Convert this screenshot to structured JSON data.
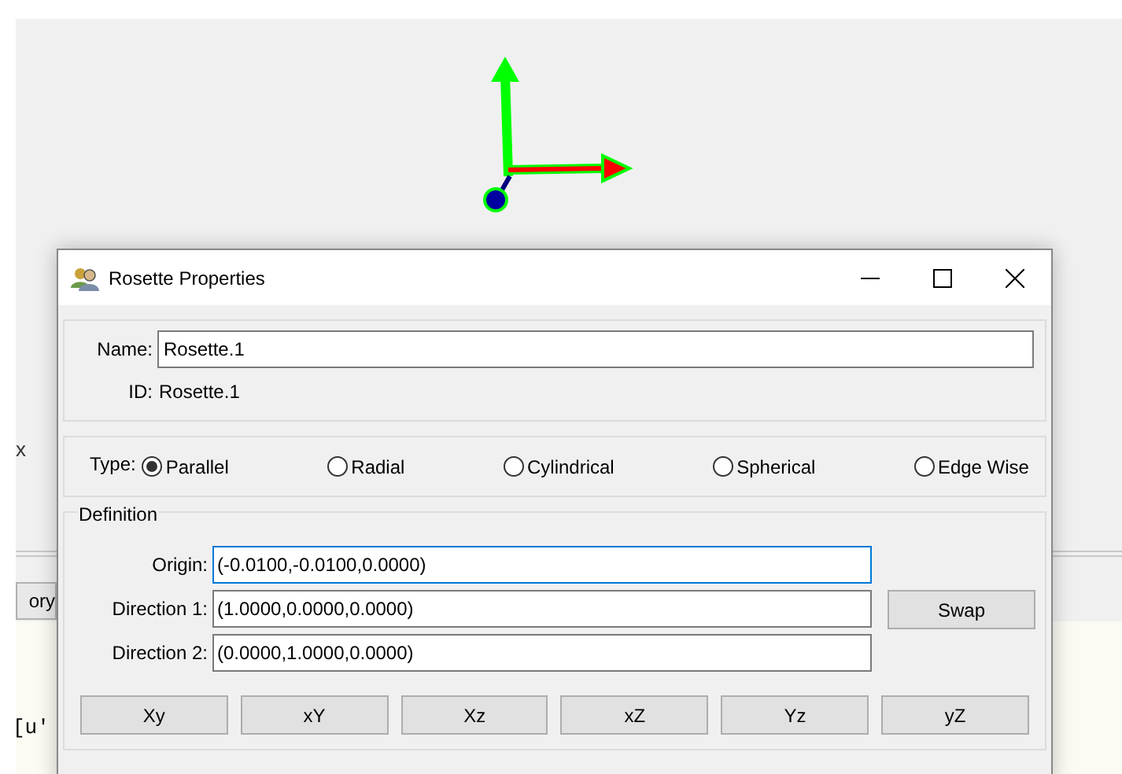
{
  "background": {
    "axis_label": "x",
    "tab": "ory",
    "console_text": "[u'"
  },
  "window": {
    "title": "Rosette Properties"
  },
  "name": {
    "label": "Name:",
    "value": "Rosette.1"
  },
  "id": {
    "label": "ID:",
    "value": "Rosette.1"
  },
  "type": {
    "label": "Type:",
    "options": [
      {
        "label": "Parallel",
        "selected": true
      },
      {
        "label": "Radial",
        "selected": false
      },
      {
        "label": "Cylindrical",
        "selected": false
      },
      {
        "label": "Spherical",
        "selected": false
      },
      {
        "label": "Edge Wise",
        "selected": false
      }
    ]
  },
  "definition": {
    "title": "Definition",
    "fields": [
      {
        "label": "Origin:",
        "value": "(-0.0100,-0.0100,0.0000)",
        "focused": true
      },
      {
        "label": "Direction 1:",
        "value": "(1.0000,0.0000,0.0000)",
        "focused": false
      },
      {
        "label": "Direction 2:",
        "value": "(0.0000,1.0000,0.0000)",
        "focused": false
      }
    ],
    "swap_button": "Swap",
    "plane_buttons": [
      "Xy",
      "xY",
      "Xz",
      "xZ",
      "Yz",
      "yZ"
    ]
  }
}
